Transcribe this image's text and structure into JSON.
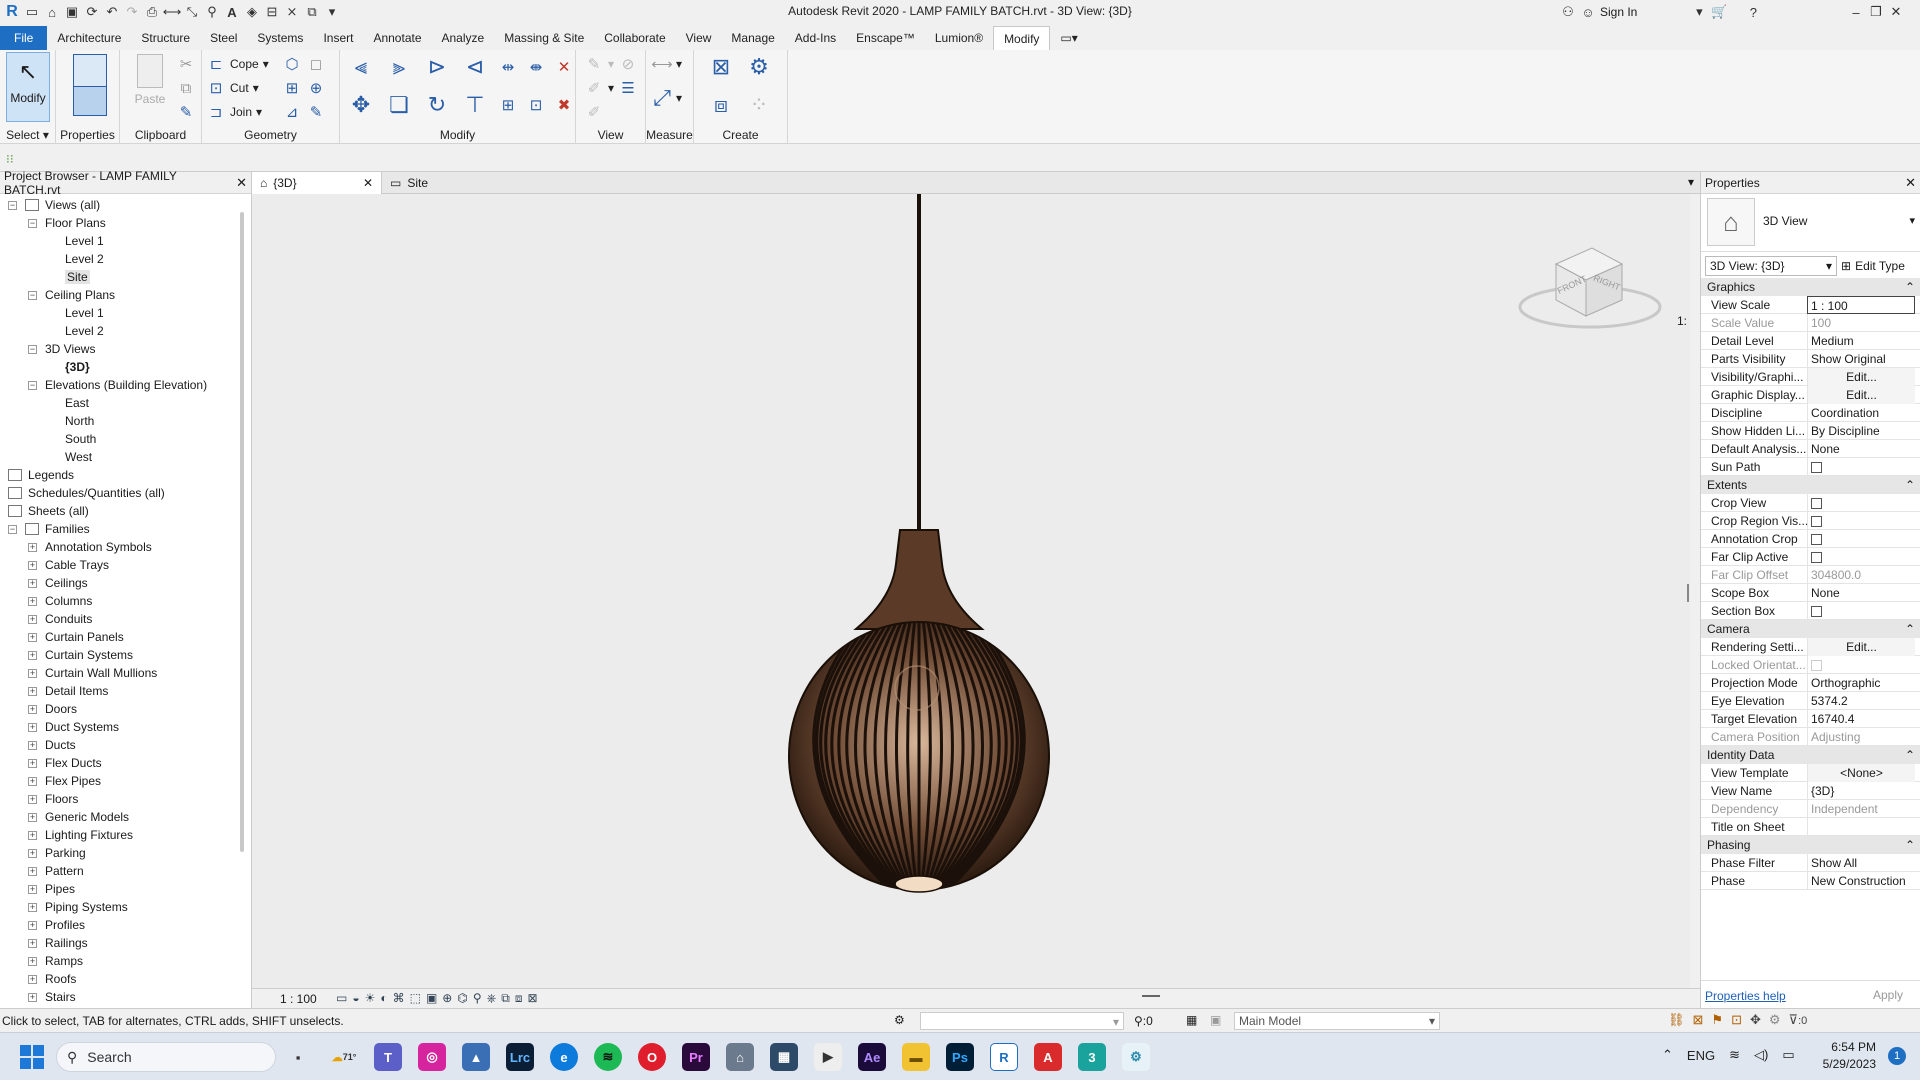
{
  "window": {
    "title": "Autodesk Revit 2020 - LAMP FAMILY BATCH.rvt - 3D View: {3D}",
    "sign_in": "Sign In"
  },
  "menu": {
    "file": "File",
    "tabs": [
      "Architecture",
      "Structure",
      "Steel",
      "Systems",
      "Insert",
      "Annotate",
      "Analyze",
      "Massing & Site",
      "Collaborate",
      "View",
      "Manage",
      "Add-Ins",
      "Enscape™",
      "Lumion®",
      "Modify"
    ],
    "active": "Modify"
  },
  "ribbon": {
    "select_panel": {
      "modify": "Modify",
      "label": "Select"
    },
    "properties_panel": {
      "label": "Properties"
    },
    "clipboard": {
      "paste": "Paste",
      "label": "Clipboard"
    },
    "geometry": {
      "cope": "Cope",
      "cut": "Cut",
      "join": "Join",
      "label": "Geometry"
    },
    "modify_label": "Modify",
    "view_label": "View",
    "measure_label": "Measure",
    "create_label": "Create"
  },
  "project_browser": {
    "title": "Project Browser - LAMP FAMILY BATCH.rvt",
    "nodes": [
      {
        "label": "Views (all)",
        "exp": "−"
      },
      {
        "label": "Floor Plans",
        "exp": "−"
      },
      {
        "label": "Level 1"
      },
      {
        "label": "Level 2"
      },
      {
        "label": "Site"
      },
      {
        "label": "Ceiling Plans",
        "exp": "−"
      },
      {
        "label": "Level 1"
      },
      {
        "label": "Level 2"
      },
      {
        "label": "3D Views",
        "exp": "−"
      },
      {
        "label": "{3D}"
      },
      {
        "label": "Elevations (Building Elevation)",
        "exp": "−"
      },
      {
        "label": "East"
      },
      {
        "label": "North"
      },
      {
        "label": "South"
      },
      {
        "label": "West"
      },
      {
        "label": "Legends"
      },
      {
        "label": "Schedules/Quantities (all)"
      },
      {
        "label": "Sheets (all)"
      },
      {
        "label": "Families",
        "exp": "−"
      },
      {
        "label": "Annotation Symbols",
        "exp": "+"
      },
      {
        "label": "Cable Trays",
        "exp": "+"
      },
      {
        "label": "Ceilings",
        "exp": "+"
      },
      {
        "label": "Columns",
        "exp": "+"
      },
      {
        "label": "Conduits",
        "exp": "+"
      },
      {
        "label": "Curtain Panels",
        "exp": "+"
      },
      {
        "label": "Curtain Systems",
        "exp": "+"
      },
      {
        "label": "Curtain Wall Mullions",
        "exp": "+"
      },
      {
        "label": "Detail Items",
        "exp": "+"
      },
      {
        "label": "Doors",
        "exp": "+"
      },
      {
        "label": "Duct Systems",
        "exp": "+"
      },
      {
        "label": "Ducts",
        "exp": "+"
      },
      {
        "label": "Flex Ducts",
        "exp": "+"
      },
      {
        "label": "Flex Pipes",
        "exp": "+"
      },
      {
        "label": "Floors",
        "exp": "+"
      },
      {
        "label": "Generic Models",
        "exp": "+"
      },
      {
        "label": "Lighting Fixtures",
        "exp": "+"
      },
      {
        "label": "Parking",
        "exp": "+"
      },
      {
        "label": "Pattern",
        "exp": "+"
      },
      {
        "label": "Pipes",
        "exp": "+"
      },
      {
        "label": "Piping Systems",
        "exp": "+"
      },
      {
        "label": "Profiles",
        "exp": "+"
      },
      {
        "label": "Railings",
        "exp": "+"
      },
      {
        "label": "Ramps",
        "exp": "+"
      },
      {
        "label": "Roofs",
        "exp": "+"
      },
      {
        "label": "Stairs",
        "exp": "+"
      }
    ]
  },
  "view_tabs": [
    {
      "label": "{3D}"
    },
    {
      "label": "Site"
    }
  ],
  "viewcube": {
    "front": "FRONT",
    "right": "RIGHT"
  },
  "view_control": {
    "scale": "1 : 100"
  },
  "properties": {
    "title": "Properties",
    "type_name": "3D View",
    "selector": "3D View: {3D}",
    "edit_type": "Edit Type",
    "sections": [
      {
        "name": "Graphics",
        "rows": [
          {
            "k": "View Scale",
            "v": "1 : 100"
          },
          {
            "k": "Scale Value",
            "v": "100",
            "v0": "1:",
            "dim": true
          },
          {
            "k": "Detail Level",
            "v": "Medium"
          },
          {
            "k": "Parts Visibility",
            "v": "Show Original"
          },
          {
            "k": "Visibility/Graphi...",
            "v": "Edit...",
            "btn": true
          },
          {
            "k": "Graphic Display...",
            "v": "Edit...",
            "btn": true
          },
          {
            "k": "Discipline",
            "v": "Coordination"
          },
          {
            "k": "Show Hidden Li...",
            "v": "By Discipline"
          },
          {
            "k": "Default Analysis...",
            "v": "None"
          },
          {
            "k": "Sun Path",
            "cb": true
          }
        ]
      },
      {
        "name": "Extents",
        "rows": [
          {
            "k": "Crop View",
            "cb": true
          },
          {
            "k": "Crop Region Vis...",
            "cb": true
          },
          {
            "k": "Annotation Crop",
            "cb": true
          },
          {
            "k": "Far Clip Active",
            "cb": true
          },
          {
            "k": "Far Clip Offset",
            "v": "304800.0",
            "dim": true
          },
          {
            "k": "Scope Box",
            "v": "None"
          },
          {
            "k": "Section Box",
            "cb": true
          }
        ]
      },
      {
        "name": "Camera",
        "rows": [
          {
            "k": "Rendering Setti...",
            "v": "Edit...",
            "btn": true
          },
          {
            "k": "Locked Orientat...",
            "cb": true,
            "dim": true
          },
          {
            "k": "Projection Mode",
            "v": "Orthographic"
          },
          {
            "k": "Eye Elevation",
            "v": "5374.2"
          },
          {
            "k": "Target Elevation",
            "v": "16740.4"
          },
          {
            "k": "Camera Position",
            "v": "Adjusting",
            "dim": true
          }
        ]
      },
      {
        "name": "Identity Data",
        "rows": [
          {
            "k": "View Template",
            "v": "<None>",
            "btn": true
          },
          {
            "k": "View Name",
            "v": "{3D}"
          },
          {
            "k": "Dependency",
            "v": "Independent",
            "dim": true
          },
          {
            "k": "Title on Sheet",
            "v": ""
          }
        ]
      },
      {
        "name": "Phasing",
        "rows": [
          {
            "k": "Phase Filter",
            "v": "Show All"
          },
          {
            "k": "Phase",
            "v": "New Construction"
          }
        ]
      }
    ],
    "help": "Properties help",
    "apply": "Apply"
  },
  "status": {
    "text": "Click to select, TAB for alternates, CTRL adds, SHIFT unselects.",
    "count": ":0",
    "model": "Main Model",
    "filter": ":0"
  },
  "taskbar": {
    "search": "Search",
    "weather": "71°",
    "lang": "ENG",
    "time": "6:54 PM",
    "date": "5/29/2023",
    "notif": "1"
  }
}
